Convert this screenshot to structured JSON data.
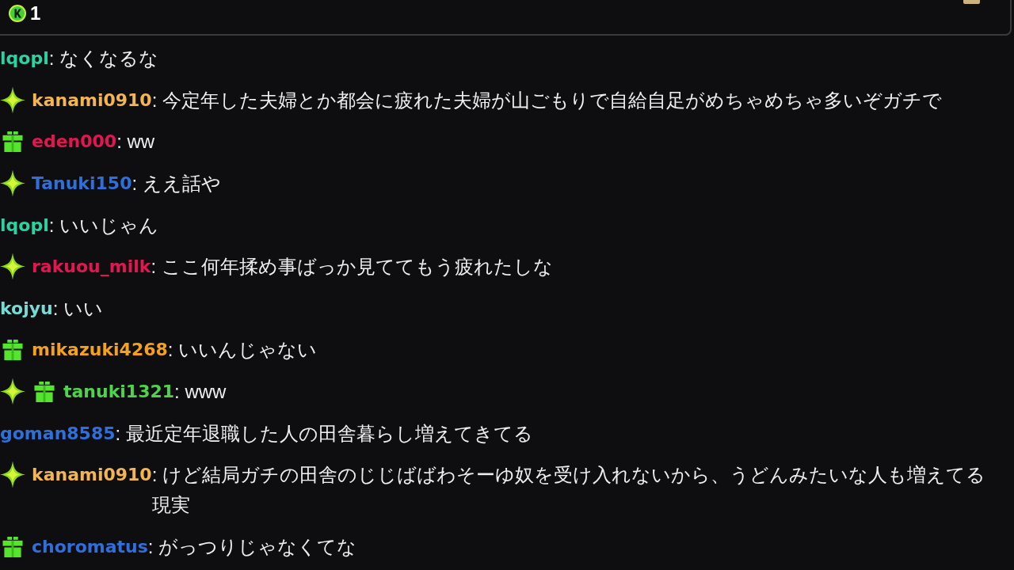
{
  "top_bar": {
    "count": "1"
  },
  "messages": [
    {
      "username": "lqopl",
      "color": "#2bd3a0",
      "text": ": なくなるな"
    },
    {
      "badges": [
        {
          "kind": "sparkle"
        }
      ],
      "username": "kanami0910",
      "color": "#f2b552",
      "text": ": 今定年した夫婦とか都会に疲れた夫婦が山ごもりで自給自足がめちゃめちゃ多いぞガチで"
    },
    {
      "badges": [
        {
          "kind": "gift"
        }
      ],
      "username": "eden000",
      "color": "#e3174f",
      "text": ": ww"
    },
    {
      "badges": [
        {
          "kind": "sparkle"
        }
      ],
      "username": "Tanuki150",
      "color": "#2f6fdc",
      "text": ": ええ話や"
    },
    {
      "username": "lqopl",
      "color": "#2bd3a0",
      "text": ": いいじゃん"
    },
    {
      "badges": [
        {
          "kind": "sparkle"
        }
      ],
      "username": "rakuou_milk",
      "color": "#e3174f",
      "text": ": ここ何年揉め事ばっか見ててもう疲れたしな"
    },
    {
      "username": "kojyu",
      "color": "#74dcd4",
      "text": ": いい"
    },
    {
      "badges": [
        {
          "kind": "gift"
        }
      ],
      "username": "mikazuki4268",
      "color": "#f3a21e",
      "text": ": いいんじゃない"
    },
    {
      "badges": [
        {
          "kind": "sparkle"
        },
        {
          "kind": "gift"
        }
      ],
      "username": "tanuki1321",
      "color": "#4fd34c",
      "text": ": www"
    },
    {
      "username": "goman8585",
      "color": "#2f6fdc",
      "text": ": 最近定年退職した人の田舎暮らし増えてきてる"
    },
    {
      "badges": [
        {
          "kind": "sparkle"
        }
      ],
      "username": "kanami0910",
      "color": "#f2b552",
      "text": ": けど結局ガチの田舎のじじばばわそーゆ奴を受け入れないから、うどんみたいな人も増えてる現実"
    },
    {
      "badges": [
        {
          "kind": "gift"
        }
      ],
      "username": "choromatus",
      "color": "#2f6fdc",
      "text": ": がっつりじゃなくてな"
    }
  ]
}
